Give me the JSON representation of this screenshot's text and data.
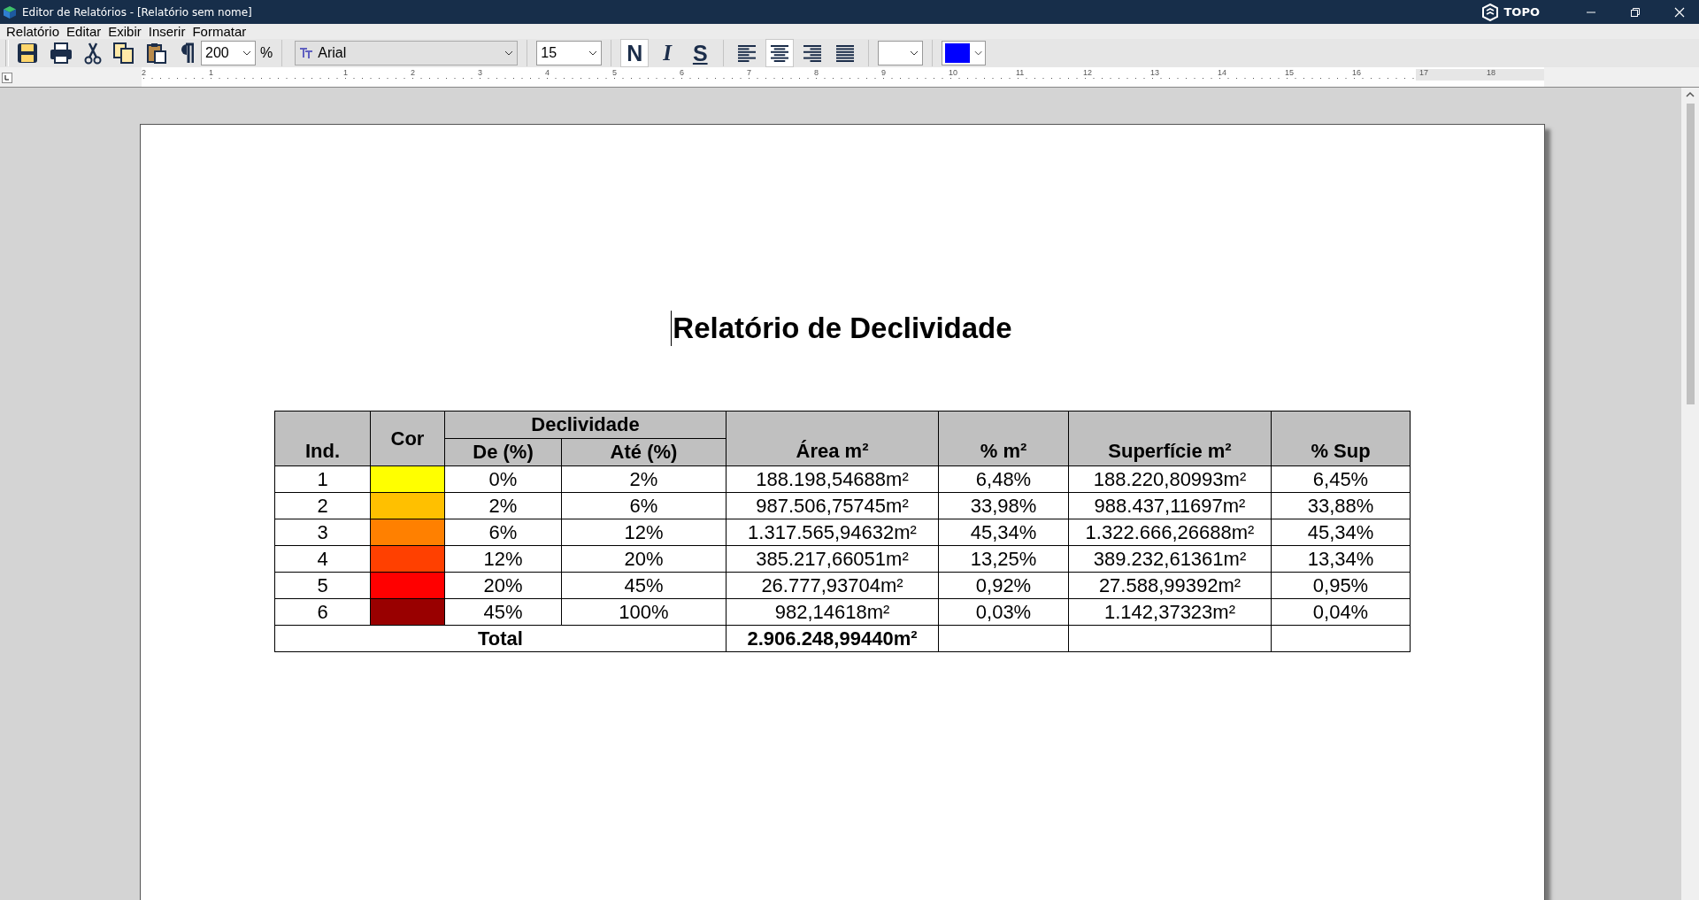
{
  "window": {
    "title": "Editor de Relatórios - [Relatório sem nome]",
    "brand": "TOPO"
  },
  "menu": [
    "Relatório",
    "Editar",
    "Exibir",
    "Inserir",
    "Formatar"
  ],
  "toolbar": {
    "zoom": "200",
    "zoom_unit": "%",
    "font": "Arial",
    "font_size": "15",
    "style_buttons": [
      {
        "label": "N",
        "kind": "bold",
        "on": true
      },
      {
        "label": "I",
        "kind": "italic",
        "on": false
      },
      {
        "label": "S",
        "kind": "underline",
        "on": false
      }
    ],
    "alignments": [
      {
        "kind": "left",
        "selected": false
      },
      {
        "kind": "center",
        "selected": true
      },
      {
        "kind": "right",
        "selected": false
      },
      {
        "kind": "justify",
        "selected": false
      }
    ],
    "color_picker": {
      "color": "#0000ff"
    }
  },
  "ruler": {
    "labels": [
      "2",
      "1",
      "1",
      "2",
      "3",
      "4",
      "5",
      "6",
      "7",
      "8",
      "9",
      "10",
      "11",
      "12",
      "13",
      "14",
      "15",
      "16",
      "17",
      "18"
    ]
  },
  "document": {
    "title": "Relatório de Declividade",
    "table": {
      "group_header": "Declividade",
      "columns": [
        "Ind.",
        "Cor",
        "De (%)",
        "Até (%)",
        "Área m²",
        "% m²",
        "Superfície m²",
        "% Sup"
      ],
      "rows": [
        {
          "index": "1",
          "color": "#ffff00",
          "from": "0%",
          "to": "2%",
          "area": "188.198,54688m²",
          "area_pct": "6,48%",
          "surface": "188.220,80993m²",
          "surface_pct": "6,45%"
        },
        {
          "index": "2",
          "color": "#ffc000",
          "from": "2%",
          "to": "6%",
          "area": "987.506,75745m²",
          "area_pct": "33,98%",
          "surface": "988.437,11697m²",
          "surface_pct": "33,88%"
        },
        {
          "index": "3",
          "color": "#ff8000",
          "from": "6%",
          "to": "12%",
          "area": "1.317.565,94632m²",
          "area_pct": "45,34%",
          "surface": "1.322.666,26688m²",
          "surface_pct": "45,34%"
        },
        {
          "index": "4",
          "color": "#ff4000",
          "from": "12%",
          "to": "20%",
          "area": "385.217,66051m²",
          "area_pct": "13,25%",
          "surface": "389.232,61361m²",
          "surface_pct": "13,34%"
        },
        {
          "index": "5",
          "color": "#ff0000",
          "from": "20%",
          "to": "45%",
          "area": "26.777,93704m²",
          "area_pct": "0,92%",
          "surface": "27.588,99392m²",
          "surface_pct": "0,95%"
        },
        {
          "index": "6",
          "color": "#990000",
          "from": "45%",
          "to": "100%",
          "area": "982,14618m²",
          "area_pct": "0,03%",
          "surface": "1.142,37323m²",
          "surface_pct": "0,04%"
        }
      ],
      "total": {
        "label": "Total",
        "area": "2.906.248,99440m²"
      }
    }
  }
}
